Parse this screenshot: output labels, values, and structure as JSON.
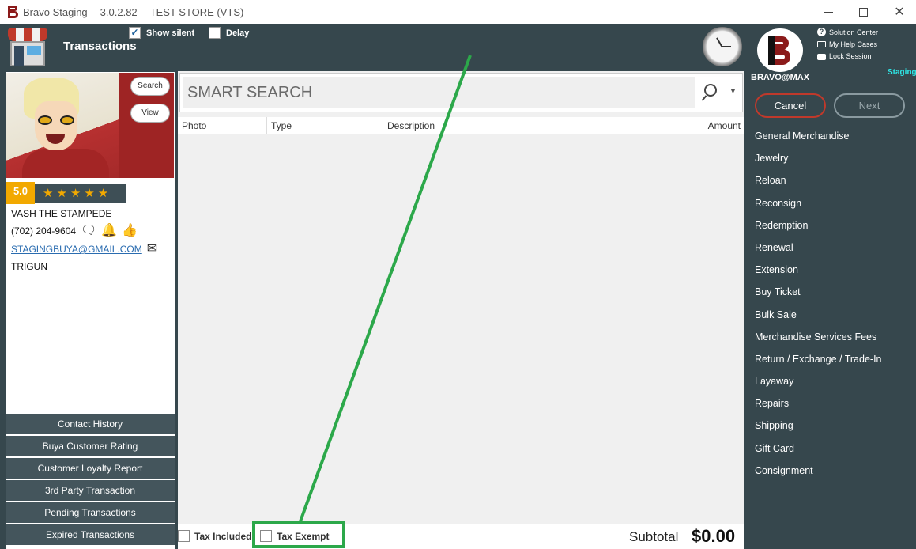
{
  "titlebar": {
    "app_name": "Bravo Staging",
    "version": "3.0.2.82",
    "store": "TEST STORE (VTS)"
  },
  "header": {
    "title": "Transactions",
    "show_silent": {
      "label": "Show silent",
      "checked": true
    },
    "delay": {
      "label": "Delay",
      "checked": false
    },
    "user": "BRAVO@MAX",
    "environment": "Staging",
    "links": [
      "Solution Center",
      "My Help Cases",
      "Lock Session"
    ]
  },
  "customer": {
    "search_label": "Search",
    "view_label": "View",
    "rating": "5.0",
    "stars": "★★★★★",
    "name": "VASH THE STAMPEDE",
    "phone": "(702) 204-9604",
    "email": "STAGINGBUYA@GMAIL.COM",
    "note": "TRIGUN"
  },
  "left_nav": [
    "Contact History",
    "Buya Customer Rating",
    "Customer Loyalty Report",
    "3rd Party Transaction",
    "Pending Transactions",
    "Expired Transactions"
  ],
  "search": {
    "placeholder": "SMART SEARCH"
  },
  "grid": {
    "columns": [
      "Photo",
      "Type",
      "Description",
      "Amount"
    ]
  },
  "footer": {
    "tax_included": {
      "label": "Tax Included",
      "checked": false
    },
    "tax_exempt": {
      "label": "Tax Exempt",
      "checked": false
    },
    "subtotal_label": "Subtotal",
    "subtotal_value": "$0.00"
  },
  "actions": {
    "cancel": "Cancel",
    "next": "Next"
  },
  "menu": [
    "General Merchandise",
    "Jewelry",
    "Reloan",
    "Reconsign",
    "Redemption",
    "Renewal",
    "Extension",
    "Buy Ticket",
    "Bulk Sale",
    "Merchandise Services Fees",
    "Return / Exchange / Trade-In",
    "Layaway",
    "Repairs",
    "Shipping",
    "Gift Card",
    "Consignment"
  ],
  "colors": {
    "accent_green": "#2ca84a",
    "brand_red": "#8b1a1a",
    "panel_bg": "#36474d",
    "star": "#f2a900",
    "env": "#2ee6e6"
  }
}
